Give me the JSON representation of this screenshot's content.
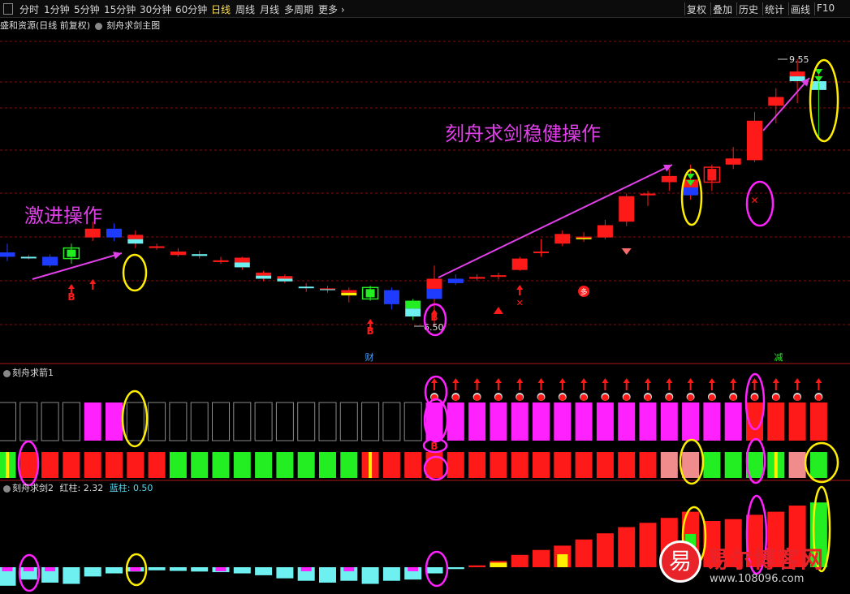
{
  "toolbar": {
    "periods": [
      "分时",
      "1分钟",
      "5分钟",
      "15分钟",
      "30分钟",
      "60分钟",
      "日线",
      "周线",
      "月线",
      "多周期",
      "更多 ›"
    ],
    "active_period": "日线",
    "right_buttons": [
      "复权",
      "叠加",
      "历史",
      "统计",
      "画线",
      "F10"
    ]
  },
  "main_panel": {
    "stock_title": "盛和资源(日线 前复权)",
    "indicator_name": "刻舟求剑主图",
    "annotation_aggressive": "激进操作",
    "annotation_steady": "刻舟求剑稳健操作",
    "high_price_label": "9.55",
    "low_price_label": "6.50",
    "b_marker": "B",
    "duo_marker": "多",
    "cai_marker": "财",
    "jian_marker": "减"
  },
  "panel2": {
    "title": "刻舟求箭1",
    "b_marker": "B"
  },
  "panel3": {
    "title": "刻舟求剑2",
    "red_label": "红柱:",
    "red_value": "2.32",
    "blue_label": "蓝柱:",
    "blue_value": "0.50"
  },
  "watermark": {
    "icon_char": "易",
    "text": "易尔博客网",
    "url": "www.108096.com"
  },
  "colors": {
    "up": "#ff1a1a",
    "down_blue": "#1e3cff",
    "cyan": "#6ef0f0",
    "magenta": "#ff22ff",
    "green": "#22ee22",
    "yellow": "#ffee00",
    "annotation": "#e040e8",
    "dashed_grid": "#7a1010"
  },
  "chart_data": {
    "type": "candlestick",
    "price_labels": {
      "high": 9.55,
      "low": 6.5
    },
    "candles": [
      {
        "o": 7.35,
        "h": 7.45,
        "l": 7.25,
        "c": 7.3,
        "color": "blue"
      },
      {
        "o": 7.29,
        "h": 7.32,
        "l": 7.27,
        "c": 7.3,
        "color": "cyan"
      },
      {
        "o": 7.3,
        "h": 7.33,
        "l": 7.18,
        "c": 7.2,
        "color": "blue"
      },
      {
        "o": 7.28,
        "h": 7.45,
        "l": 7.22,
        "c": 7.4,
        "color": "green_box"
      },
      {
        "o": 7.52,
        "h": 7.7,
        "l": 7.48,
        "c": 7.62,
        "color": "red"
      },
      {
        "o": 7.62,
        "h": 7.68,
        "l": 7.48,
        "c": 7.52,
        "color": "blue"
      },
      {
        "o": 7.55,
        "h": 7.6,
        "l": 7.4,
        "c": 7.45,
        "color": "red_cyan"
      },
      {
        "o": 7.42,
        "h": 7.45,
        "l": 7.38,
        "c": 7.4,
        "color": "red"
      },
      {
        "o": 7.36,
        "h": 7.4,
        "l": 7.3,
        "c": 7.32,
        "color": "red"
      },
      {
        "o": 7.33,
        "h": 7.37,
        "l": 7.28,
        "c": 7.31,
        "color": "cyan"
      },
      {
        "o": 7.26,
        "h": 7.3,
        "l": 7.22,
        "c": 7.24,
        "color": "red"
      },
      {
        "o": 7.29,
        "h": 7.3,
        "l": 7.15,
        "c": 7.18,
        "color": "red_cyan"
      },
      {
        "o": 7.12,
        "h": 7.14,
        "l": 7.02,
        "c": 7.05,
        "color": "red_cyan"
      },
      {
        "o": 7.08,
        "h": 7.1,
        "l": 7.0,
        "c": 7.02,
        "color": "red_cyan"
      },
      {
        "o": 6.96,
        "h": 7.0,
        "l": 6.9,
        "c": 6.95,
        "color": "cyan"
      },
      {
        "o": 6.94,
        "h": 6.97,
        "l": 6.89,
        "c": 6.92,
        "color": "red_cyan"
      },
      {
        "o": 6.86,
        "h": 6.95,
        "l": 6.78,
        "c": 6.92,
        "color": "red_yellow"
      },
      {
        "o": 6.82,
        "h": 6.97,
        "l": 6.8,
        "c": 6.95,
        "color": "green_box"
      },
      {
        "o": 6.92,
        "h": 6.95,
        "l": 6.7,
        "c": 6.76,
        "color": "blue"
      },
      {
        "o": 6.8,
        "h": 6.82,
        "l": 6.58,
        "c": 6.62,
        "color": "green_cyan"
      },
      {
        "o": 6.82,
        "h": 7.2,
        "l": 6.5,
        "c": 7.05,
        "color": "red_blue"
      },
      {
        "o": 7.05,
        "h": 7.1,
        "l": 6.98,
        "c": 7.0,
        "color": "blue"
      },
      {
        "o": 7.07,
        "h": 7.1,
        "l": 7.03,
        "c": 7.05,
        "color": "red"
      },
      {
        "o": 7.08,
        "h": 7.12,
        "l": 7.04,
        "c": 7.09,
        "color": "red"
      },
      {
        "o": 7.15,
        "h": 7.3,
        "l": 7.14,
        "c": 7.28,
        "color": "red"
      },
      {
        "o": 7.35,
        "h": 7.5,
        "l": 7.3,
        "c": 7.36,
        "color": "red"
      },
      {
        "o": 7.45,
        "h": 7.6,
        "l": 7.42,
        "c": 7.56,
        "color": "red"
      },
      {
        "o": 7.5,
        "h": 7.58,
        "l": 7.47,
        "c": 7.53,
        "color": "red_yellow"
      },
      {
        "o": 7.52,
        "h": 7.72,
        "l": 7.5,
        "c": 7.66,
        "color": "red"
      },
      {
        "o": 7.7,
        "h": 8.02,
        "l": 7.65,
        "c": 7.99,
        "color": "red"
      },
      {
        "o": 8.0,
        "h": 8.05,
        "l": 7.88,
        "c": 8.02,
        "color": "red"
      },
      {
        "o": 8.15,
        "h": 8.3,
        "l": 8.05,
        "c": 8.22,
        "color": "red"
      },
      {
        "o": 8.0,
        "h": 8.35,
        "l": 7.95,
        "c": 8.18,
        "color": "red_blue"
      },
      {
        "o": 8.15,
        "h": 8.35,
        "l": 8.05,
        "c": 8.32,
        "color": "red_box"
      },
      {
        "o": 8.35,
        "h": 8.55,
        "l": 8.3,
        "c": 8.42,
        "color": "red"
      },
      {
        "o": 8.4,
        "h": 8.95,
        "l": 8.38,
        "c": 8.85,
        "color": "red"
      },
      {
        "o": 9.02,
        "h": 9.22,
        "l": 8.82,
        "c": 9.12,
        "color": "red"
      },
      {
        "o": 9.3,
        "h": 9.55,
        "l": 9.05,
        "c": 9.41,
        "color": "red_cyan"
      },
      {
        "o": 9.3,
        "h": 9.38,
        "l": 8.9,
        "c": 9.2,
        "color": "cyan"
      }
    ],
    "panel2_bars": [
      {
        "top": "empty",
        "bottom": "green_yellow"
      },
      {
        "top": "empty",
        "bottom": "red"
      },
      {
        "top": "empty",
        "bottom": "red"
      },
      {
        "top": "empty",
        "bottom": "red"
      },
      {
        "top": "magenta",
        "bottom": "red"
      },
      {
        "top": "magenta",
        "bottom": "red"
      },
      {
        "top": "empty",
        "bottom": "red"
      },
      {
        "top": "empty",
        "bottom": "red"
      },
      {
        "top": "empty",
        "bottom": "green"
      },
      {
        "top": "empty",
        "bottom": "green"
      },
      {
        "top": "empty",
        "bottom": "green"
      },
      {
        "top": "empty",
        "bottom": "green"
      },
      {
        "top": "empty",
        "bottom": "green"
      },
      {
        "top": "empty",
        "bottom": "green"
      },
      {
        "top": "empty",
        "bottom": "green"
      },
      {
        "top": "empty",
        "bottom": "green"
      },
      {
        "top": "empty",
        "bottom": "green"
      },
      {
        "top": "empty",
        "bottom": "red_yellow"
      },
      {
        "top": "empty",
        "bottom": "red"
      },
      {
        "top": "empty",
        "bottom": "red"
      },
      {
        "top": "magenta",
        "bottom": "red"
      },
      {
        "top": "magenta",
        "bottom": "red"
      },
      {
        "top": "magenta",
        "bottom": "red"
      },
      {
        "top": "magenta",
        "bottom": "red"
      },
      {
        "top": "magenta",
        "bottom": "red"
      },
      {
        "top": "magenta",
        "bottom": "red"
      },
      {
        "top": "magenta",
        "bottom": "red"
      },
      {
        "top": "magenta",
        "bottom": "red"
      },
      {
        "top": "magenta",
        "bottom": "red"
      },
      {
        "top": "magenta",
        "bottom": "red"
      },
      {
        "top": "magenta",
        "bottom": "red"
      },
      {
        "top": "magenta",
        "bottom": "pink"
      },
      {
        "top": "magenta",
        "bottom": "pink"
      },
      {
        "top": "magenta",
        "bottom": "green"
      },
      {
        "top": "magenta",
        "bottom": "green"
      },
      {
        "top": "red",
        "bottom": "green"
      },
      {
        "top": "red",
        "bottom": "green_yellow"
      },
      {
        "top": "red",
        "bottom": "pink"
      },
      {
        "top": "red",
        "bottom": "green"
      }
    ],
    "panel3_bars": [
      {
        "v": -0.3,
        "color": "cyan",
        "cap": "magenta"
      },
      {
        "v": -0.2,
        "color": "cyan",
        "cap": "magenta"
      },
      {
        "v": -0.25,
        "color": "cyan",
        "cap": "magenta"
      },
      {
        "v": -0.27,
        "color": "cyan"
      },
      {
        "v": -0.15,
        "color": "cyan"
      },
      {
        "v": -0.1,
        "color": "cyan"
      },
      {
        "v": -0.07,
        "color": "cyan",
        "cap": "magenta"
      },
      {
        "v": -0.05,
        "color": "cyan"
      },
      {
        "v": -0.06,
        "color": "cyan"
      },
      {
        "v": -0.07,
        "color": "cyan"
      },
      {
        "v": -0.08,
        "color": "cyan",
        "cap": "magenta"
      },
      {
        "v": -0.1,
        "color": "cyan"
      },
      {
        "v": -0.13,
        "color": "cyan"
      },
      {
        "v": -0.18,
        "color": "cyan"
      },
      {
        "v": -0.22,
        "color": "cyan",
        "cap": "magenta"
      },
      {
        "v": -0.25,
        "color": "cyan"
      },
      {
        "v": -0.22,
        "color": "cyan",
        "cap": "magenta"
      },
      {
        "v": -0.27,
        "color": "cyan"
      },
      {
        "v": -0.22,
        "color": "cyan"
      },
      {
        "v": -0.2,
        "color": "cyan",
        "cap": "magenta"
      },
      {
        "v": -0.1,
        "color": "cyan"
      },
      {
        "v": -0.03,
        "color": "cyan"
      },
      {
        "v": 0.03,
        "color": "red"
      },
      {
        "v": 0.1,
        "color": "yellow_red"
      },
      {
        "v": 0.2,
        "color": "red"
      },
      {
        "v": 0.28,
        "color": "red"
      },
      {
        "v": 0.35,
        "color": "red",
        "cap": "yellow"
      },
      {
        "v": 0.45,
        "color": "red"
      },
      {
        "v": 0.55,
        "color": "red"
      },
      {
        "v": 0.65,
        "color": "red"
      },
      {
        "v": 0.72,
        "color": "red"
      },
      {
        "v": 0.8,
        "color": "red"
      },
      {
        "v": 0.9,
        "color": "red",
        "cap": "green"
      },
      {
        "v": 0.75,
        "color": "red"
      },
      {
        "v": 0.78,
        "color": "red"
      },
      {
        "v": 0.85,
        "color": "red"
      },
      {
        "v": 0.9,
        "color": "red"
      },
      {
        "v": 1.0,
        "color": "red"
      },
      {
        "v": 1.05,
        "color": "green"
      }
    ]
  }
}
